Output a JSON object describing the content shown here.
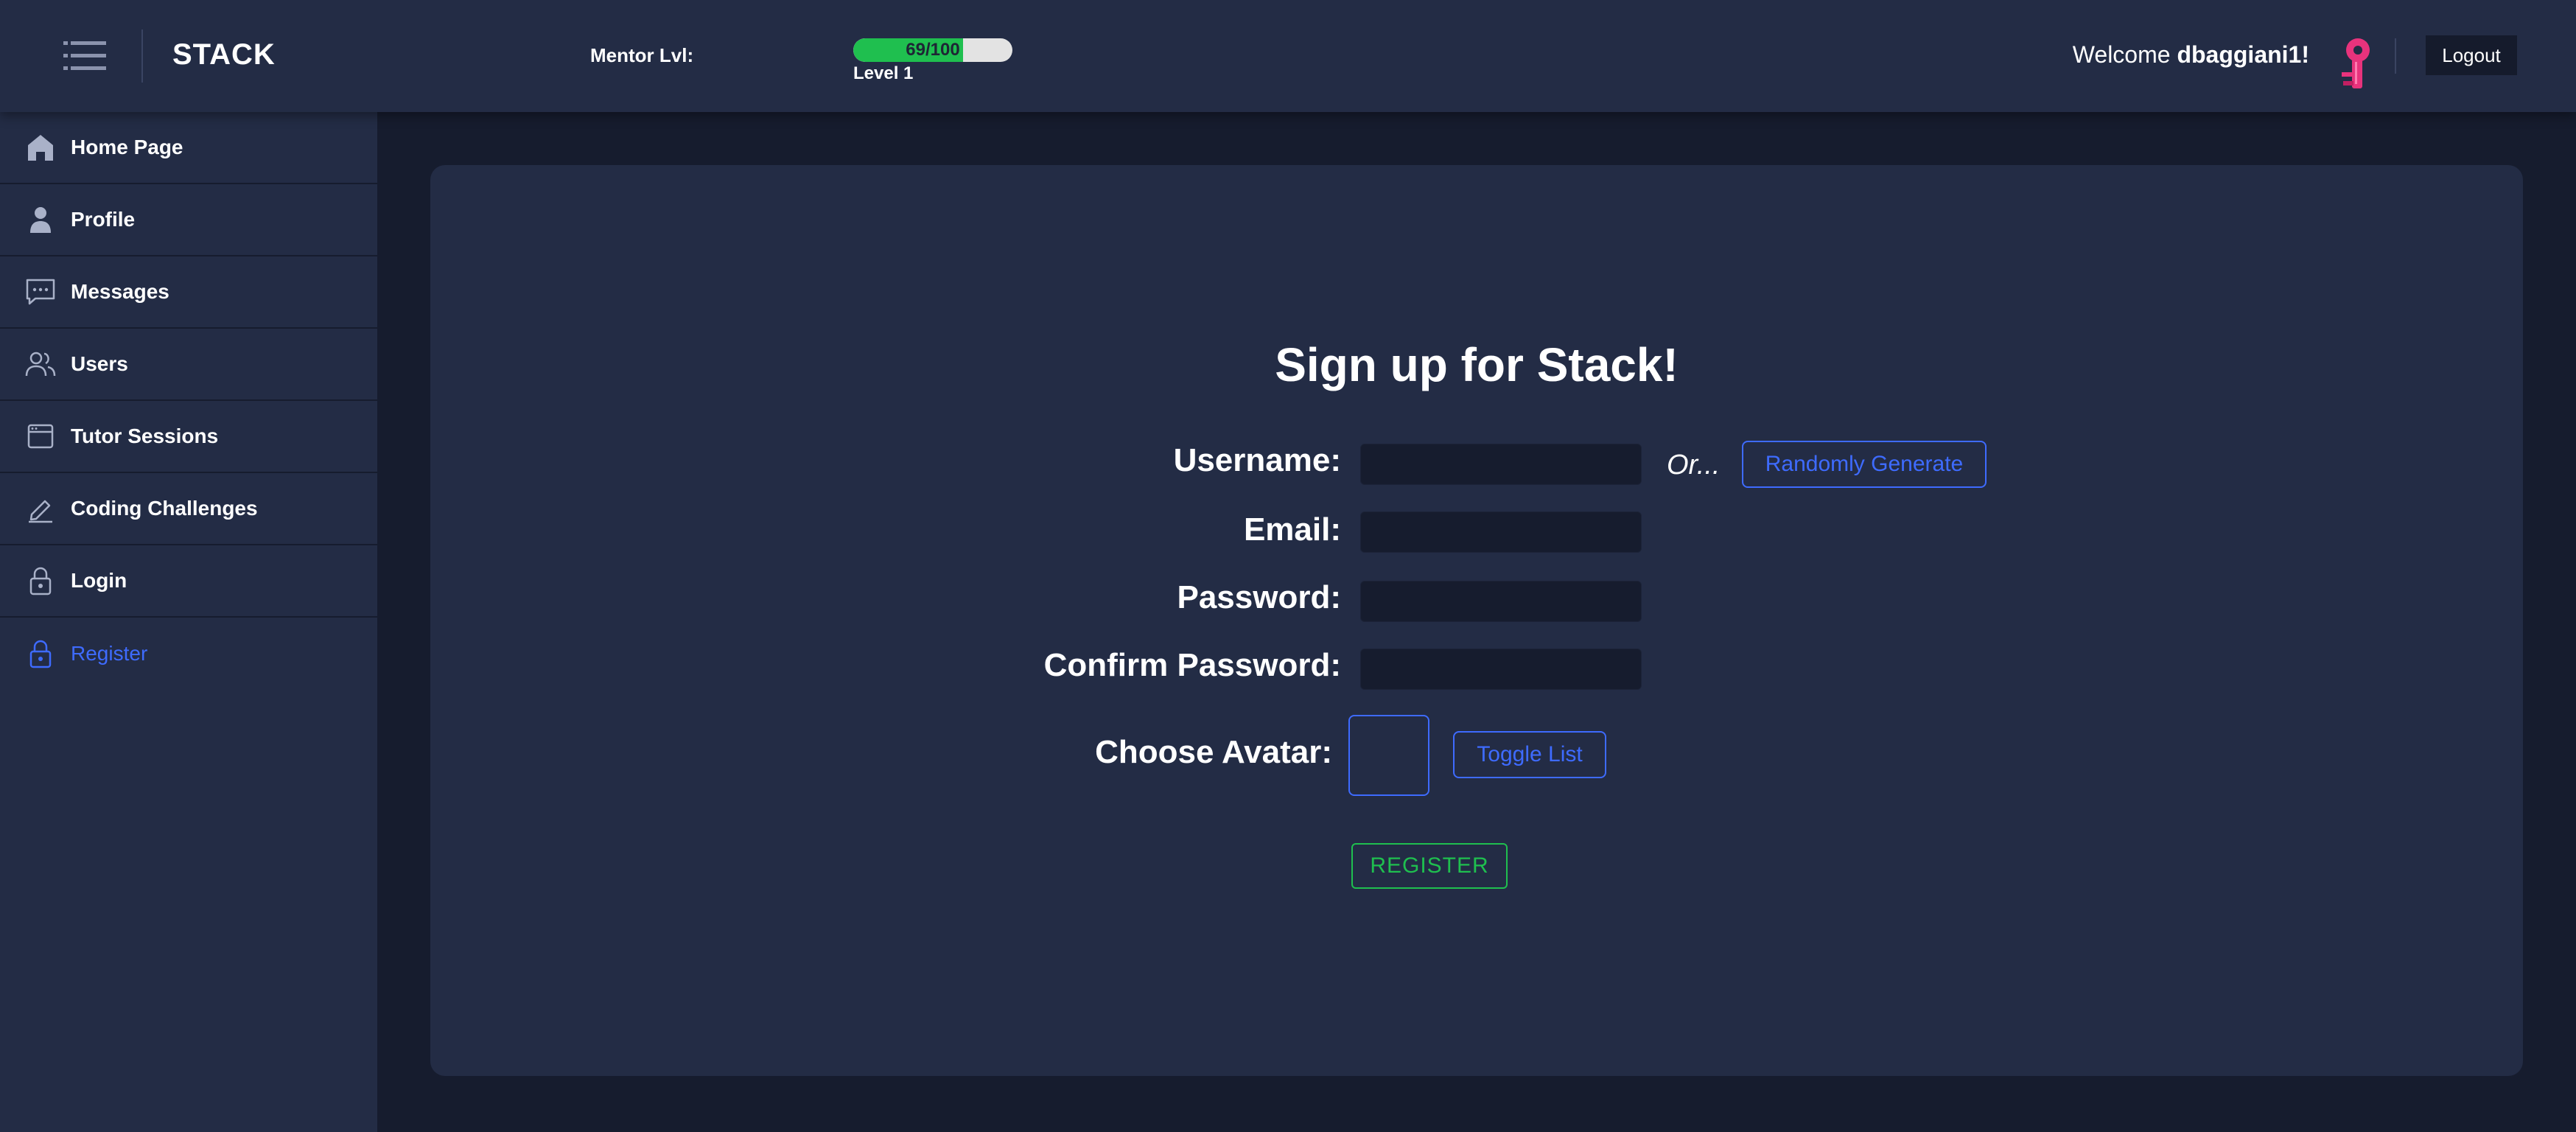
{
  "header": {
    "brand": "STACK",
    "mentor_label": "Mentor Lvl:",
    "progress_text": "69/100",
    "progress_fraction": 0.69,
    "level_text": "Level 1",
    "welcome_prefix": "Welcome ",
    "username": "dbaggiani1!",
    "logout_label": "Logout",
    "avatar_icon": "pink-key-avatar-icon",
    "menu_icon": "hamburger-menu-icon"
  },
  "sidebar": {
    "items": [
      {
        "label": "Home Page",
        "icon": "home-icon"
      },
      {
        "label": "Profile",
        "icon": "person-icon"
      },
      {
        "label": "Messages",
        "icon": "chat-icon"
      },
      {
        "label": "Users",
        "icon": "users-icon"
      },
      {
        "label": "Tutor Sessions",
        "icon": "window-icon"
      },
      {
        "label": "Coding Challenges",
        "icon": "pencil-icon"
      },
      {
        "label": "Login",
        "icon": "lock-icon"
      },
      {
        "label": "Register",
        "icon": "lock-icon",
        "active": true
      }
    ]
  },
  "form": {
    "title": "Sign up for Stack!",
    "username_label": "Username:",
    "username_value": "",
    "or_text": "Or...",
    "random_label": "Randomly Generate",
    "email_label": "Email:",
    "email_value": "",
    "password_label": "Password:",
    "password_value": "",
    "confirm_label": "Confirm Password:",
    "confirm_value": "",
    "avatar_label": "Choose Avatar:",
    "toggle_label": "Toggle List",
    "register_label": "REGISTER"
  },
  "colors": {
    "background": "#161c2e",
    "panel": "#232c45",
    "accent_blue": "#3e6bff",
    "accent_green": "#1fbf4f",
    "avatar_pink": "#e8337c"
  }
}
